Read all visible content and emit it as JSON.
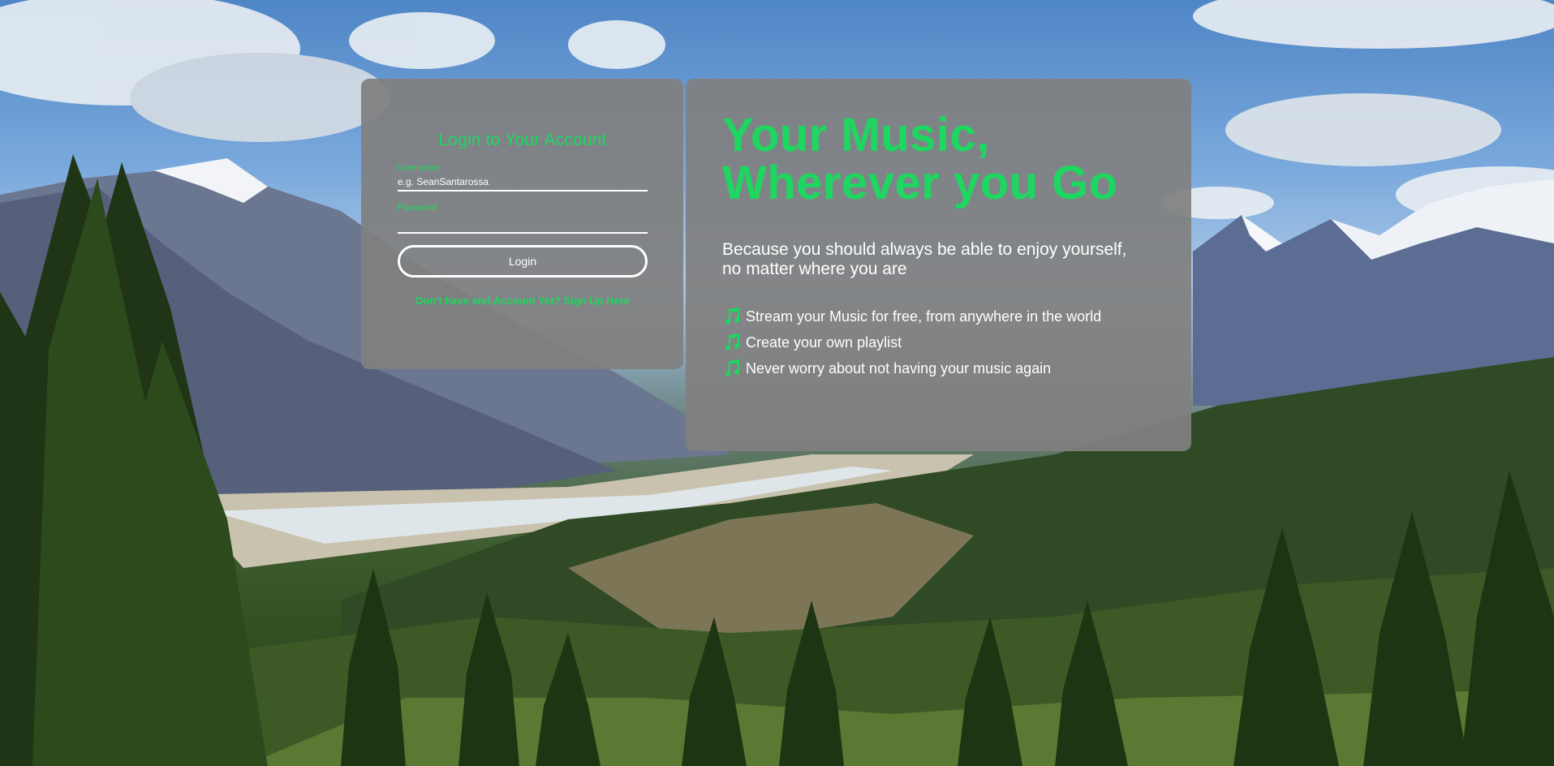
{
  "login": {
    "title": "Login to Your Account",
    "username_label": "Username",
    "username_placeholder": "e.g. SeanSantarossa",
    "username_value": "",
    "password_label": "Password",
    "password_value": "",
    "login_button": "Login",
    "signup_link": "Don't have and Account Yet? Sign Up Here"
  },
  "promo": {
    "title_line1": "Your Music,",
    "title_line2": "Wherever you Go",
    "subtitle": "Because you should always be able to enjoy yourself, no matter where you are",
    "features": [
      {
        "icon": "music-note-icon",
        "text": "Stream your Music for free, from anywhere in the world"
      },
      {
        "icon": "music-note-icon",
        "text": "Create your own playlist"
      },
      {
        "icon": "music-note-icon",
        "text": "Never worry about not having your music again"
      }
    ]
  },
  "colors": {
    "accent": "#1ed760",
    "panel": "#808080",
    "text": "#ffffff"
  }
}
